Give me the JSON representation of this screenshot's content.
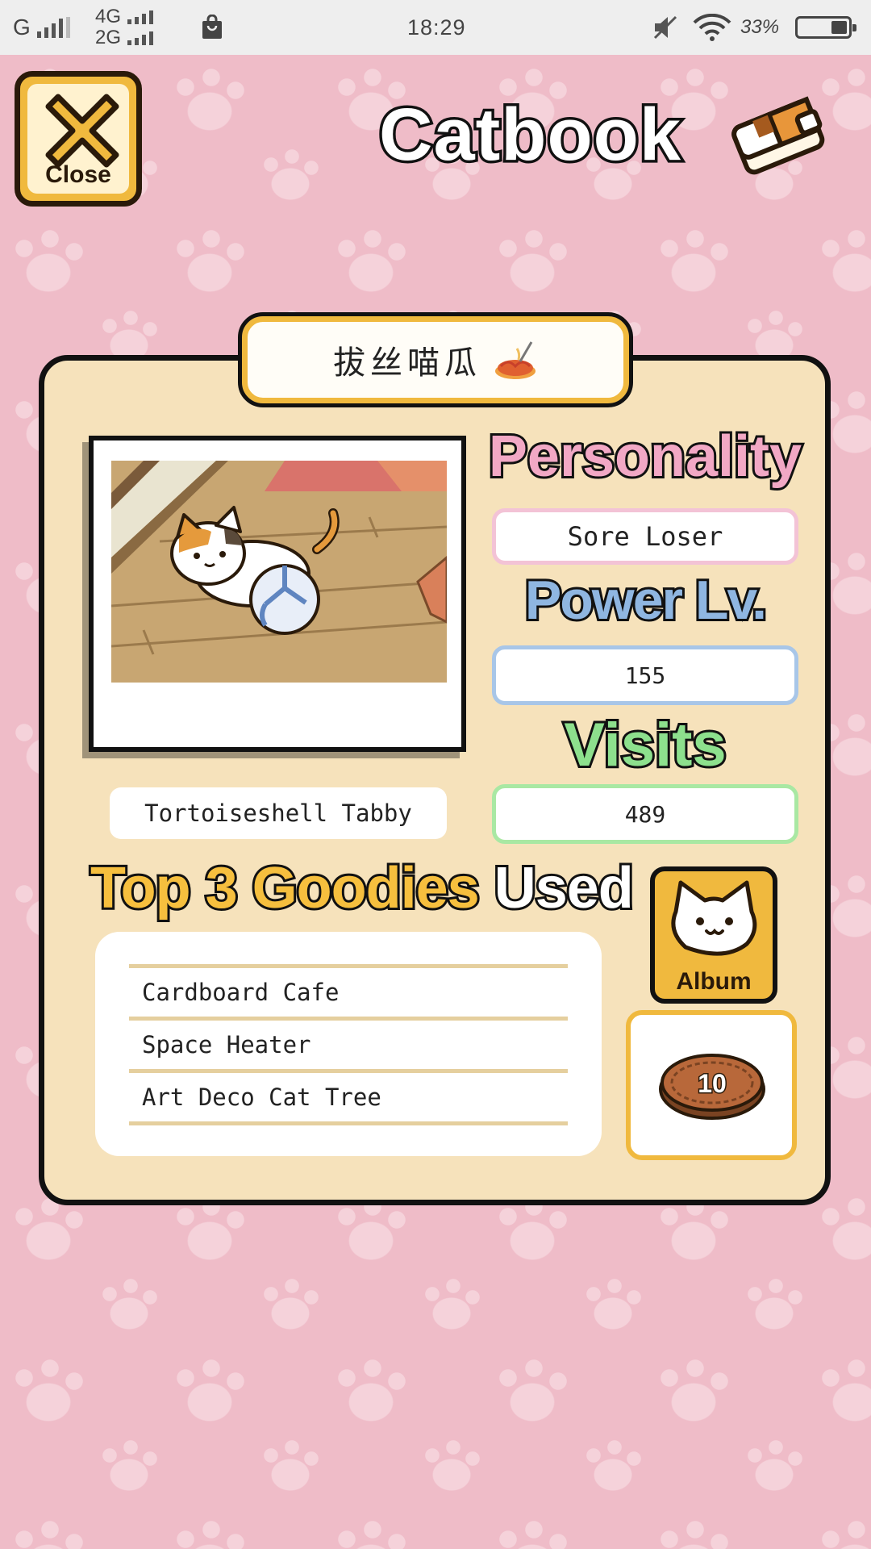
{
  "status_bar": {
    "carrier_1": "G",
    "net_top": "4G",
    "net_bottom": "2G",
    "time": "18:29",
    "battery_text": "33",
    "battery_level": 0.33,
    "icons": [
      "signal-icon",
      "shopping-bag-icon",
      "mute-icon",
      "wifi-icon",
      "battery-icon"
    ]
  },
  "header": {
    "close_label": "Close",
    "title": "Catbook",
    "book_icon": "catbook-icon"
  },
  "cat": {
    "name": "拔丝喵瓜",
    "breed": "Tortoiseshell Tabby"
  },
  "stats": {
    "personality_heading": "Personality",
    "personality_value": "Sore Loser",
    "power_heading": "Power Lv.",
    "power_value": "155",
    "visits_heading": "Visits",
    "visits_value": "489"
  },
  "goodies": {
    "heading_highlight": "Top 3 Goodies",
    "heading_rest": "Used",
    "items": [
      "Cardboard Cafe",
      "Space Heater",
      "Art Deco Cat Tree"
    ]
  },
  "album": {
    "label": "Album"
  },
  "coin": {
    "value": "10"
  },
  "colors": {
    "background_pink": "#efbcc8",
    "card_cream": "#f6e2bb",
    "accent_yellow": "#f0b93e",
    "personality_pink": "#f2a8c5",
    "power_blue": "#8fb6e1",
    "visits_green": "#8de08d"
  }
}
